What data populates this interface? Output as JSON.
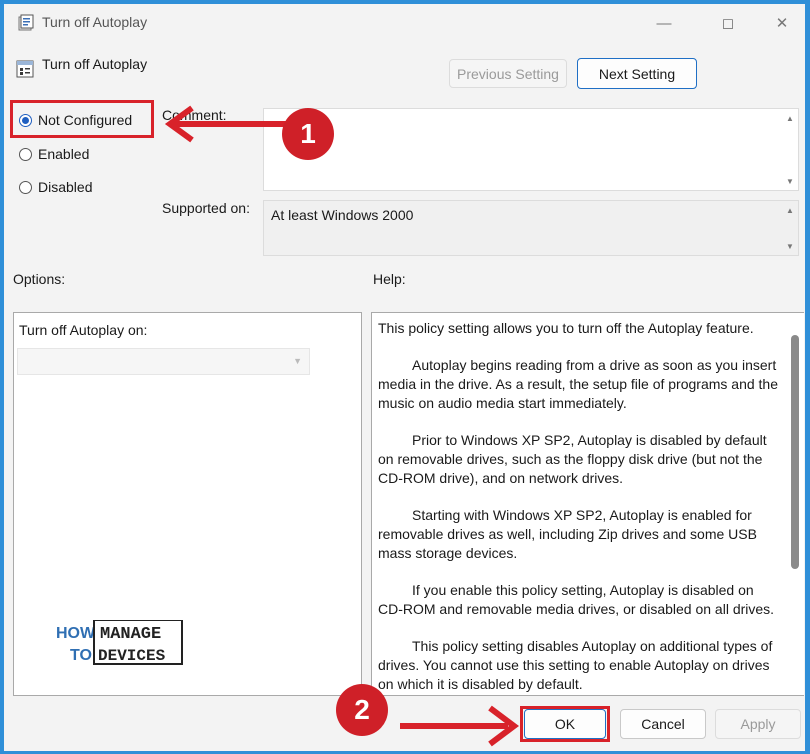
{
  "window": {
    "title": "Turn off Autoplay",
    "controls": [
      "minimize",
      "maximize",
      "close"
    ]
  },
  "header": {
    "policy_title": "Turn off Autoplay",
    "prev_button": "Previous Setting",
    "next_button": "Next Setting"
  },
  "state": {
    "options": [
      {
        "label": "Not Configured",
        "checked": true
      },
      {
        "label": "Enabled",
        "checked": false
      },
      {
        "label": "Disabled",
        "checked": false
      }
    ]
  },
  "comment": {
    "label": "Comment:",
    "value": ""
  },
  "supported": {
    "label": "Supported on:",
    "value": "At least Windows 2000"
  },
  "options_panel": {
    "heading": "Options:",
    "field_label": "Turn off Autoplay on:",
    "dropdown_value": ""
  },
  "help_panel": {
    "heading": "Help:",
    "paragraphs": [
      "This policy setting allows you to turn off the Autoplay feature.",
      "Autoplay begins reading from a drive as soon as you insert media in the drive. As a result, the setup file of programs and the music on audio media start immediately.",
      "Prior to Windows XP SP2, Autoplay is disabled by default on removable drives, such as the floppy disk drive (but not the CD-ROM drive), and on network drives.",
      "Starting with Windows XP SP2, Autoplay is enabled for removable drives as well, including Zip drives and some USB mass storage devices.",
      "If you enable this policy setting, Autoplay is disabled on CD-ROM and removable media drives, or disabled on all drives.",
      "This policy setting disables Autoplay on additional types of drives. You cannot use this setting to enable Autoplay on drives on which it is disabled by default."
    ]
  },
  "footer": {
    "ok": "OK",
    "cancel": "Cancel",
    "apply": "Apply"
  },
  "annotations": {
    "step1": "1",
    "step2": "2",
    "highlight_color": "#d8222a"
  },
  "watermark": {
    "line1_a": "HOW",
    "line1_b": "MANAGE",
    "line2_a": "TO",
    "line2_b": "DEVICES"
  }
}
